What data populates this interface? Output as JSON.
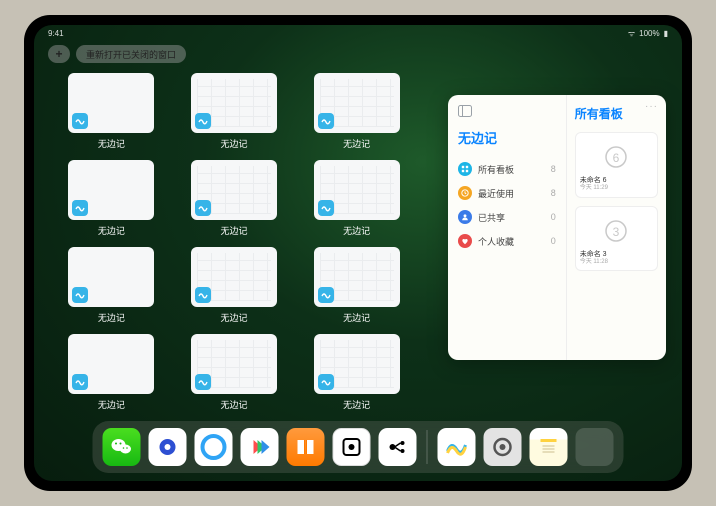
{
  "status": {
    "time": "9:41",
    "battery": "100%"
  },
  "topbar": {
    "plus": "+",
    "reopen": "重新打开已关闭的窗口"
  },
  "app_name": "无边记",
  "tiles": [
    {
      "label": "无边记",
      "variant": "blank"
    },
    {
      "label": "无边记",
      "variant": "grid"
    },
    {
      "label": "无边记",
      "variant": "grid"
    },
    {
      "label": "无边记",
      "variant": "blank"
    },
    {
      "label": "无边记",
      "variant": "grid"
    },
    {
      "label": "无边记",
      "variant": "grid"
    },
    {
      "label": "无边记",
      "variant": "blank"
    },
    {
      "label": "无边记",
      "variant": "grid"
    },
    {
      "label": "无边记",
      "variant": "grid"
    },
    {
      "label": "无边记",
      "variant": "blank"
    },
    {
      "label": "无边记",
      "variant": "grid"
    },
    {
      "label": "无边记",
      "variant": "grid"
    }
  ],
  "panel": {
    "left_title": "无边记",
    "right_title": "所有看板",
    "more": "···",
    "items": [
      {
        "label": "所有看板",
        "count": 8,
        "color": "#1db5e6",
        "icon": "grid"
      },
      {
        "label": "最近使用",
        "count": 8,
        "color": "#f5a623",
        "icon": "clock"
      },
      {
        "label": "已共享",
        "count": 0,
        "color": "#3b7be8",
        "icon": "people"
      },
      {
        "label": "个人收藏",
        "count": 0,
        "color": "#e94b4b",
        "icon": "heart"
      }
    ],
    "boards": [
      {
        "name": "未命名 6",
        "time": "今天 11:29",
        "digit": "6"
      },
      {
        "name": "未命名 3",
        "time": "今天 11:28",
        "digit": "3"
      }
    ]
  },
  "dock": [
    {
      "name": "wechat",
      "cls": "di-wechat"
    },
    {
      "name": "quark",
      "cls": "di-quark"
    },
    {
      "name": "qqbrowser",
      "cls": "di-qqb"
    },
    {
      "name": "video",
      "cls": "di-video"
    },
    {
      "name": "books",
      "cls": "di-books"
    },
    {
      "name": "notion",
      "cls": "di-notion"
    },
    {
      "name": "xmind",
      "cls": "di-xmind"
    },
    {
      "name": "sep"
    },
    {
      "name": "freeform",
      "cls": "di-freeform"
    },
    {
      "name": "settings",
      "cls": "di-settings"
    },
    {
      "name": "notes",
      "cls": "di-notes"
    },
    {
      "name": "app-library",
      "cls": "di-library"
    }
  ]
}
